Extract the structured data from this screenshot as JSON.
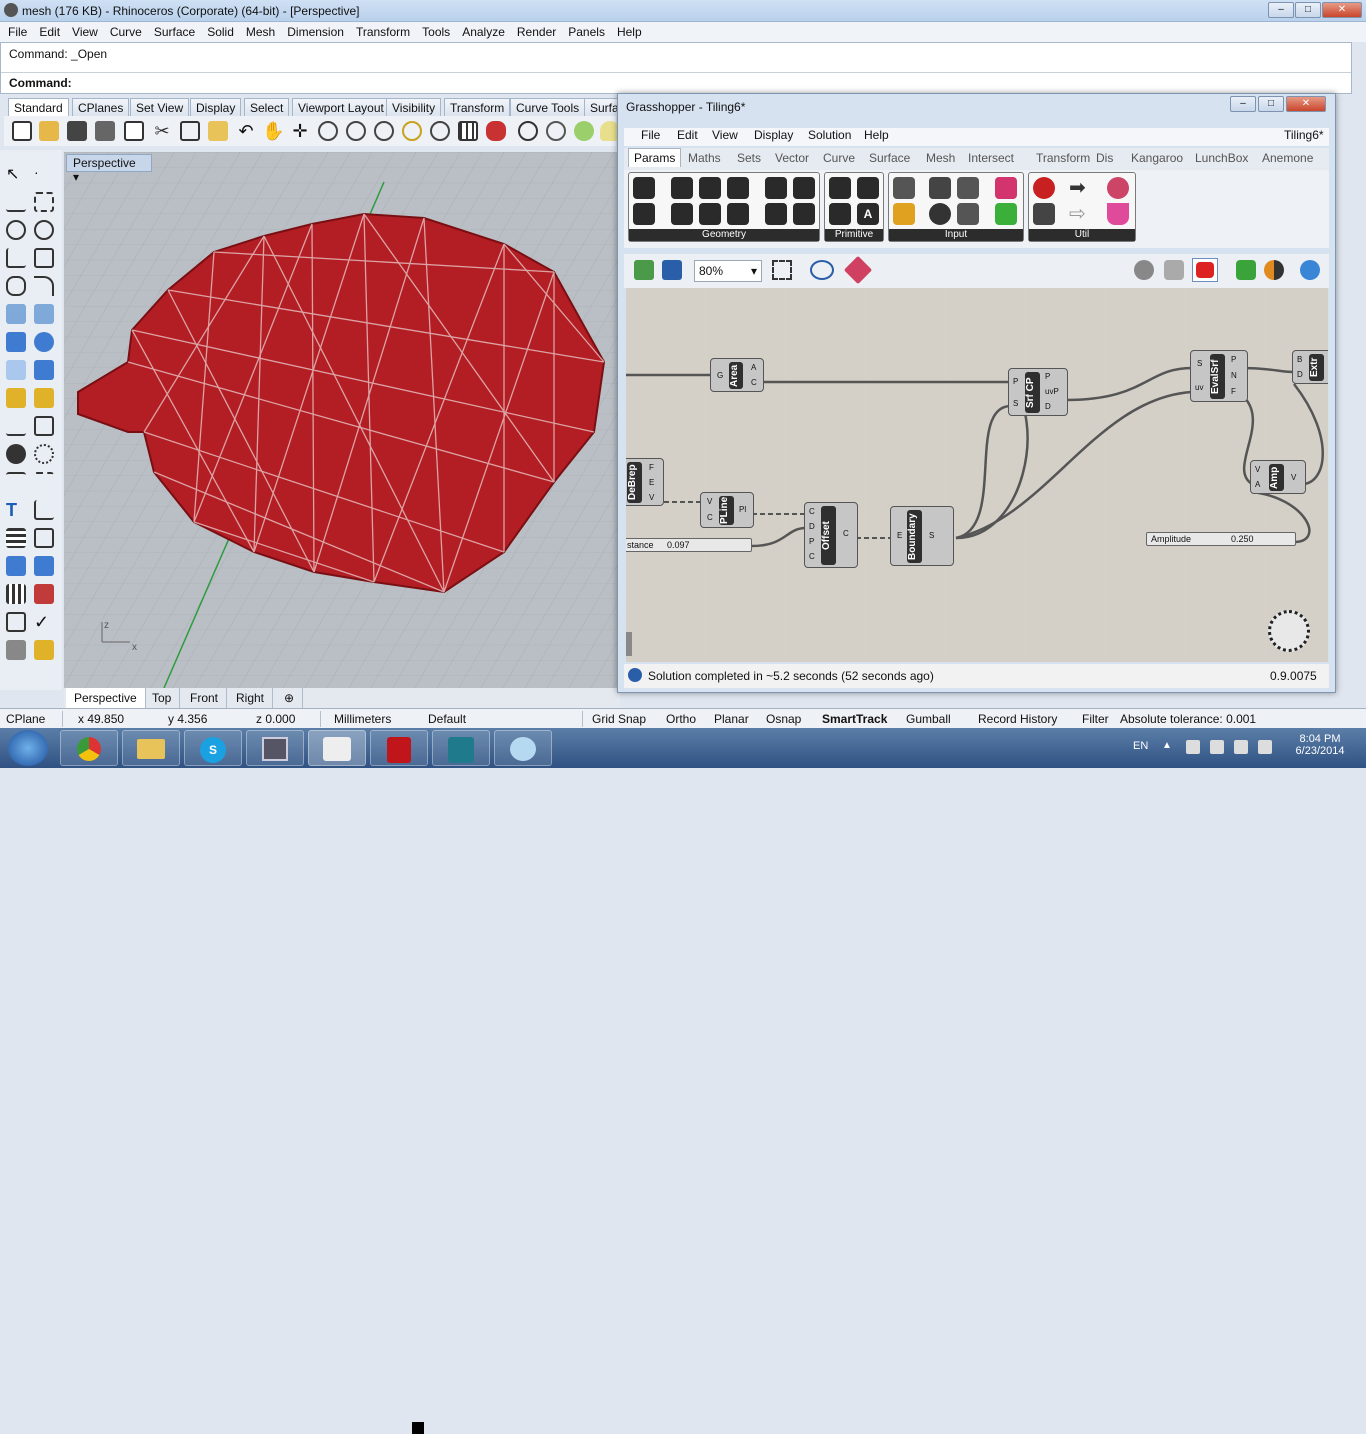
{
  "window": {
    "title": "mesh (176 KB) - Rhinoceros (Corporate) (64-bit) - [Perspective]",
    "controls": {
      "minimize": "–",
      "restore": "□",
      "close": "✕"
    }
  },
  "menu": [
    "File",
    "Edit",
    "View",
    "Curve",
    "Surface",
    "Solid",
    "Mesh",
    "Dimension",
    "Transform",
    "Tools",
    "Analyze",
    "Render",
    "Panels",
    "Help"
  ],
  "command": {
    "history": "Command: _Open",
    "prompt": "Command:"
  },
  "toolbar_tabs": [
    "Standard",
    "CPlanes",
    "Set View",
    "Display",
    "Select",
    "Viewport Layout",
    "Visibility",
    "Transform",
    "Curve Tools",
    "Surfa"
  ],
  "viewport": {
    "title": "Perspective",
    "tabs": [
      "Perspective",
      "Top",
      "Front",
      "Right",
      "⊕"
    ],
    "axis": {
      "z": "z",
      "x": "x"
    }
  },
  "status": {
    "cplane": "CPlane",
    "x": "x 49.850",
    "y": "y 4.356",
    "z": "z 0.000",
    "units": "Millimeters",
    "layer": "Default",
    "toggles": [
      "Grid Snap",
      "Ortho",
      "Planar",
      "Osnap",
      "SmartTrack",
      "Gumball",
      "Record History",
      "Filter"
    ],
    "tolerance": "Absolute tolerance: 0.001"
  },
  "taskbar": {
    "lang": "EN",
    "time": "8:04 PM",
    "date": "6/23/2014"
  },
  "grasshopper": {
    "title": "Grasshopper - Tiling6*",
    "doc_name": "Tiling6*",
    "menu": [
      "File",
      "Edit",
      "View",
      "Display",
      "Solution",
      "Help"
    ],
    "tabs": [
      "Params",
      "Maths",
      "Sets",
      "Vector",
      "Curve",
      "Surface",
      "Mesh",
      "Intersect",
      "Transform",
      "Dis",
      "Kangaroo",
      "LunchBox",
      "Anemone"
    ],
    "groups": [
      "Geometry",
      "Primitive",
      "Input",
      "Util"
    ],
    "zoom": "80%",
    "components": {
      "area": {
        "name": "Area",
        "in": [
          "G"
        ],
        "out": [
          "A",
          "C"
        ]
      },
      "srfcp": {
        "name": "Srf CP",
        "in": [
          "P",
          "S"
        ],
        "out": [
          "P",
          "uvP",
          "D"
        ]
      },
      "evalsrf": {
        "name": "EvalSrf",
        "in": [
          "S",
          "uv"
        ],
        "out": [
          "P",
          "N",
          "F"
        ]
      },
      "extr": {
        "name": "Extr",
        "in": [
          "B",
          "D"
        ]
      },
      "amp": {
        "name": "Amp",
        "in": [
          "V",
          "A"
        ],
        "out": [
          "V"
        ]
      },
      "debrep": {
        "name": "DeBrep",
        "out": [
          "F",
          "E",
          "V"
        ]
      },
      "pline": {
        "name": "PLine",
        "in": [
          "V",
          "C"
        ],
        "out": [
          "Pl"
        ]
      },
      "offset": {
        "name": "Offset",
        "in": [
          "C",
          "D",
          "P",
          "C"
        ],
        "out": [
          "C"
        ]
      },
      "boundary": {
        "name": "Boundary",
        "in": [
          "E"
        ],
        "out": [
          "S"
        ]
      }
    },
    "sliders": {
      "distance": {
        "label": "stance",
        "value": "0.097"
      },
      "amplitude": {
        "label": "Amplitude",
        "value": "0.250"
      }
    },
    "status": "Solution completed in ~5.2 seconds (52 seconds ago)",
    "version": "0.9.0075"
  },
  "colors": {
    "mesh": "#b21e24",
    "viewport_bg": "#b9bfc4",
    "gh_canvas": "#d4d0c8"
  }
}
